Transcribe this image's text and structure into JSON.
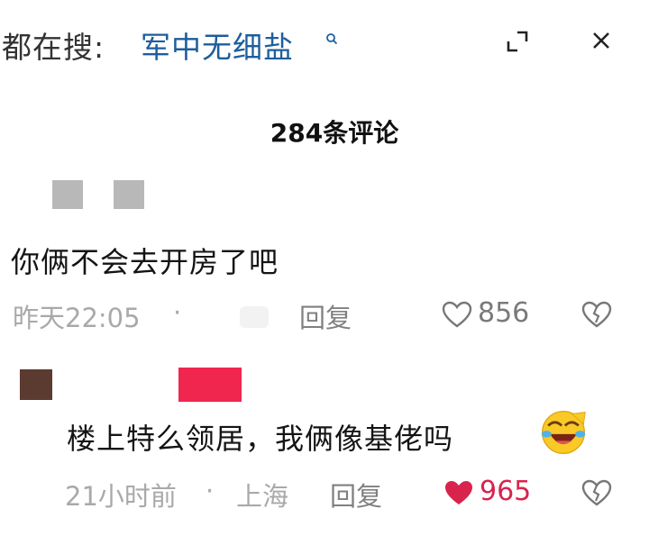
{
  "search": {
    "prefix": "都在搜:",
    "query": "军中无细盐"
  },
  "comments_header": {
    "count_label": "284条评论"
  },
  "comments": [
    {
      "text": "你俩不会去开房了吧",
      "time": "昨天22:05",
      "separator": "·",
      "location": "",
      "reply_label": "回复",
      "likes": "856",
      "liked": false
    },
    {
      "text": "楼上特么领居，我俩像基佬吗",
      "time": "21小时前",
      "separator": "·",
      "location": "上海",
      "reply_label": "回复",
      "likes": "965",
      "liked": true
    }
  ],
  "colors": {
    "query": "#1d5e9c",
    "liked": "#d8244d",
    "meta": "#a9a9a9"
  }
}
